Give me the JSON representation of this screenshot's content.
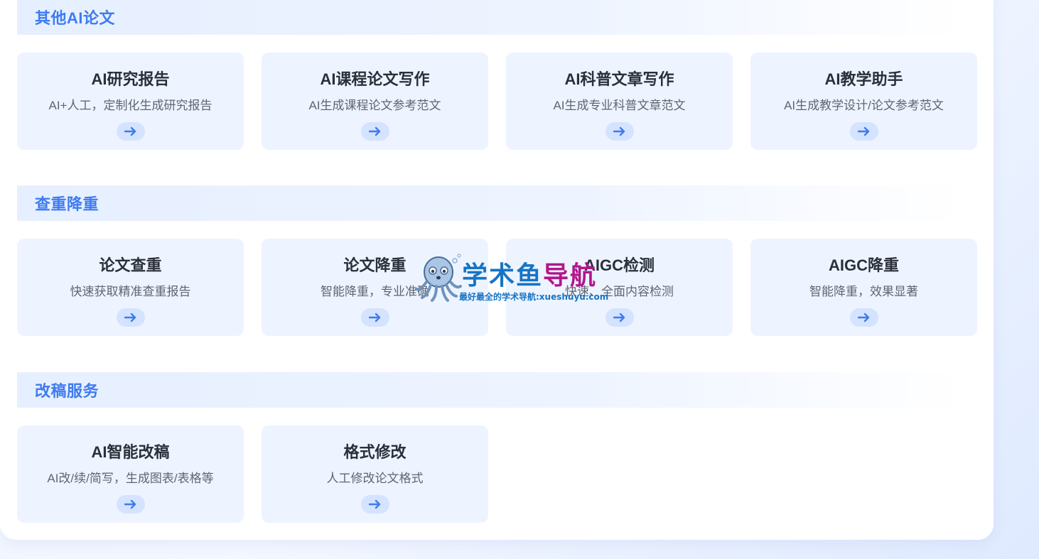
{
  "sections": [
    {
      "title": "其他AI论文",
      "cards": [
        {
          "title": "AI研究报告",
          "desc": "AI+人工，定制化生成研究报告"
        },
        {
          "title": "AI课程论文写作",
          "desc": "AI生成课程论文参考范文"
        },
        {
          "title": "AI科普文章写作",
          "desc": "AI生成专业科普文章范文"
        },
        {
          "title": "AI教学助手",
          "desc": "AI生成教学设计/论文参考范文"
        }
      ]
    },
    {
      "title": "查重降重",
      "cards": [
        {
          "title": "论文查重",
          "desc": "快速获取精准查重报告"
        },
        {
          "title": "论文降重",
          "desc": "智能降重，专业准确"
        },
        {
          "title": "AIGC检测",
          "desc": "快速、全面内容检测"
        },
        {
          "title": "AIGC降重",
          "desc": "智能降重，效果显著"
        }
      ]
    },
    {
      "title": "改稿服务",
      "cards": [
        {
          "title": "AI智能改稿",
          "desc": "AI改/续/简写，生成图表/表格等"
        },
        {
          "title": "格式修改",
          "desc": "人工修改论文格式"
        }
      ]
    }
  ],
  "watermark": {
    "brand_part1": "学术鱼",
    "brand_part2": "导航",
    "subtitle": "最好最全的学术导航:xueshuyu.com"
  },
  "colors": {
    "accent": "#3f7bf0",
    "card_bg": "#edf4ff",
    "arrow_bg": "#d4e3ff",
    "arrow": "#3f7bf0"
  },
  "icons": {
    "card_arrow": "arrow-right-icon",
    "mascot": "octopus-mascot-icon"
  }
}
